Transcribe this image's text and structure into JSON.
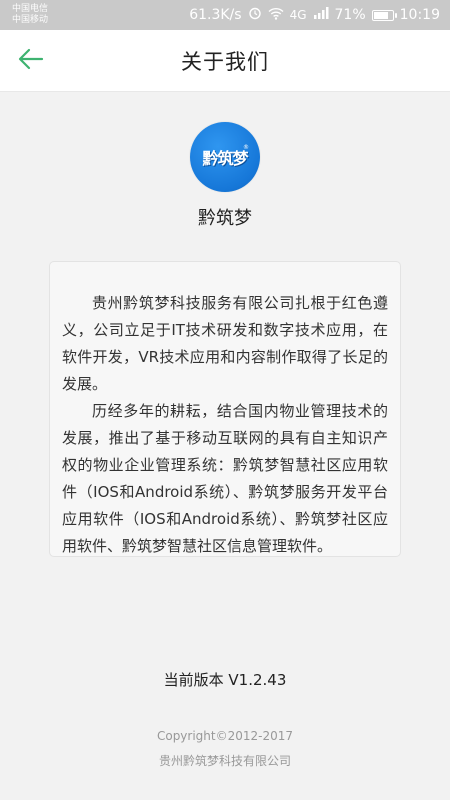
{
  "status_bar": {
    "carrier_1": "中国电信",
    "carrier_2": "中国移动",
    "net_speed": "61.3K/s",
    "signal_text": "4G",
    "battery_percent": "71%",
    "battery_level": 0.71,
    "time": "10:19",
    "icons": [
      "alarm-icon",
      "wifi-icon",
      "signal-icon",
      "battery-icon"
    ]
  },
  "nav": {
    "back_icon": "arrow-left-icon",
    "title": "关于我们",
    "accent_color": "#3eb370"
  },
  "app": {
    "logo_text": "黔筑梦",
    "logo_color": "#1677d8",
    "name": "黔筑梦"
  },
  "description": {
    "paragraph_1": "贵州黔筑梦科技服务有限公司扎根于红色遵义，公司立足于IT技术研发和数字技术应用，在软件开发，VR技术应用和内容制作取得了长足的发展。",
    "paragraph_2": "历经多年的耕耘，结合国内物业管理技术的发展，推出了基于移动互联网的具有自主知识产权的物业企业管理系统：黔筑梦智慧社区应用软件（IOS和Android系统）、黔筑梦服务开发平台应用软件（IOS和Android系统）、黔筑梦社区应用软件、黔筑梦智慧社区信息管理软件。"
  },
  "footer": {
    "version": "当前版本  V1.2.43",
    "copyright": "Copyright©2012-2017",
    "company": "贵州黔筑梦科技有限公司"
  }
}
